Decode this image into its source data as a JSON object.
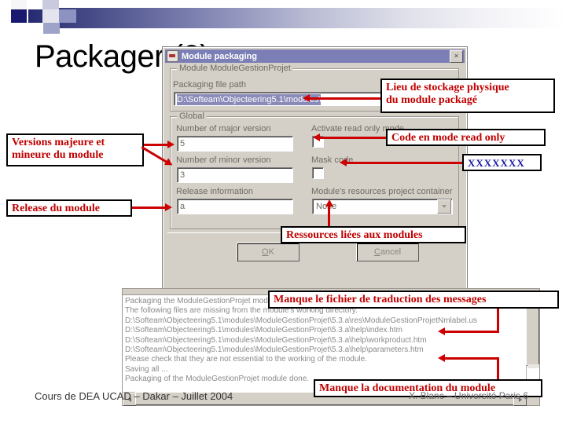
{
  "slide": {
    "title": "Packager (2)",
    "footer_left": "Cours de DEA UCAD – Dakar – Juillet 2004",
    "footer_right": "X. Blanc – Université Paris 6"
  },
  "dialog": {
    "title": "Module packaging",
    "close_label": "×",
    "module_group_legend": "Module ModuleGestionProjet",
    "packaging_path_label": "Packaging file path",
    "packaging_path_value": "D:\\Softeam\\Objecteering5.1\\modules\\",
    "global_group_legend": "Global",
    "major_version_label": "Number of major version",
    "major_version_value": "5",
    "minor_version_label": "Number of minor version",
    "minor_version_value": "3",
    "release_info_label": "Release information",
    "release_info_value": "a",
    "read_only_label": "Activate read only mode",
    "mask_code_label": "Mask code",
    "resources_label": "Module's resources project container",
    "resources_value": "None",
    "ok_label": "OK",
    "ok_accel": "O",
    "cancel_label": "Cancel",
    "cancel_accel": "C"
  },
  "log": {
    "lines": [
      "Packaging the ModuleGestionProjet module ...",
      "The following files are missing from the module's working directory.",
      "D:\\Softeam\\Objecteering5.1\\modules\\ModuleGestionProjet\\5.3.a\\res\\ModuleGestionProjetNmlabel.us",
      "D:\\Softeam\\Objecteering5.1\\modules\\ModuleGestionProjet\\5.3.a\\help\\index.htm",
      "D:\\Softeam\\Objecteering5.1\\modules\\ModuleGestionProjet\\5.3.a\\help\\workproduct.htm",
      "D:\\Softeam\\Objecteering5.1\\modules\\ModuleGestionProjet\\5.3.a\\help\\parameters.htm",
      "Please check that they are not essential to the working of the module.",
      "Saving all ...",
      "Packaging of the ModuleGestionProjet module done."
    ]
  },
  "annotations": {
    "storage": "Lieu de stockage physique\ndu module packagé",
    "storage_line1": "Lieu de stockage physique",
    "storage_line2": "du module packagé",
    "versions_line1": "Versions majeure et",
    "versions_line2": "mineure du module",
    "release": "Release du module",
    "read_only": "Code en mode read only",
    "masked": "XXXXXXX",
    "resources": "Ressources liées aux modules",
    "missing_translation": "Manque le fichier de traduction des messages",
    "missing_doc": "Manque la documentation du module"
  },
  "colors": {
    "annotation_red": "#c00000",
    "annotation_blue": "#1a1a9e",
    "titlebar": "#7b7fb5",
    "band_dark": "#262a72",
    "dialog_face": "#d4d0c8"
  }
}
